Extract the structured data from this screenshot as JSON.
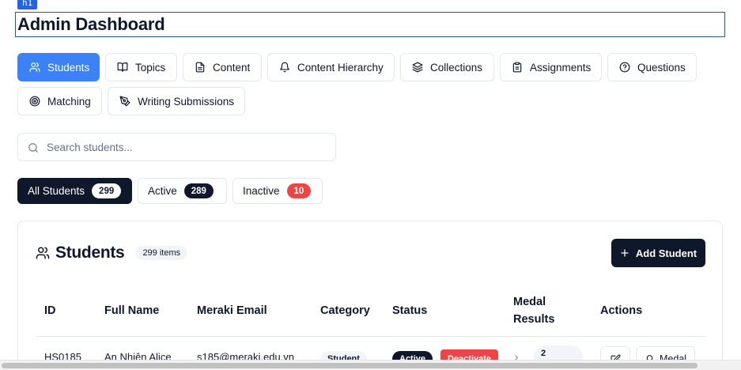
{
  "devtools": {
    "tag_label": "h1"
  },
  "page": {
    "title": "Admin Dashboard"
  },
  "tabs": [
    {
      "label": "Students",
      "icon": "users-icon",
      "active": true
    },
    {
      "label": "Topics",
      "icon": "book-open-icon"
    },
    {
      "label": "Content",
      "icon": "file-text-icon"
    },
    {
      "label": "Content Hierarchy",
      "icon": "bell-icon"
    },
    {
      "label": "Collections",
      "icon": "layers-icon"
    },
    {
      "label": "Assignments",
      "icon": "clipboard-icon"
    },
    {
      "label": "Questions",
      "icon": "help-circle-icon"
    },
    {
      "label": "Matching",
      "icon": "target-icon"
    },
    {
      "label": "Writing Submissions",
      "icon": "pen-tool-icon"
    }
  ],
  "search": {
    "placeholder": "Search students...",
    "value": ""
  },
  "filters": [
    {
      "label": "All Students",
      "count": "299",
      "active": true
    },
    {
      "label": "Active",
      "count": "289"
    },
    {
      "label": "Inactive",
      "count": "10"
    }
  ],
  "card": {
    "title": "Students",
    "count_label": "299 items",
    "add_button": "Add Student"
  },
  "table": {
    "headers": {
      "id": "ID",
      "full_name": "Full Name",
      "email": "Meraki Email",
      "category": "Category",
      "status": "Status",
      "medal_line1": "Medal",
      "medal_line2": "Results",
      "actions": "Actions"
    },
    "rows": [
      {
        "id": "HS0185",
        "full_name": "An Nhiên Alice",
        "email": "s185@meraki.edu.vn",
        "category": "Student",
        "status": "Active",
        "deactivate": "Deactivate",
        "medal_count": "2",
        "medal_button": "Medal"
      }
    ]
  },
  "colors": {
    "accent": "#3b82f6",
    "dark": "#0f172a",
    "danger": "#ef4444",
    "border": "#e2e8f0"
  }
}
